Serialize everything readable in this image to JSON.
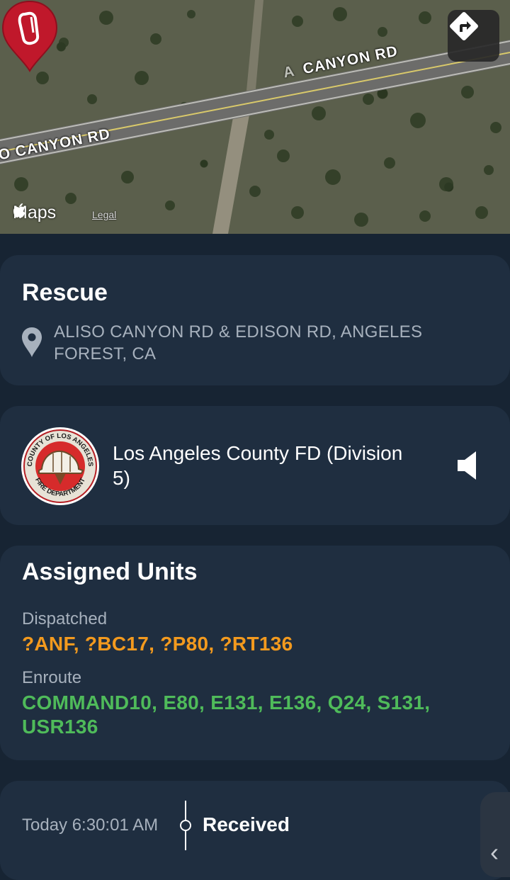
{
  "map": {
    "road_label_top": "CANYON RD",
    "road_label_top_prefix": "A",
    "road_label_left": "O CANYON RD",
    "provider": "Maps",
    "legal": "Legal",
    "directions_icon": "turn-right-arrow-icon",
    "pin_icon": "carabiner-icon",
    "pin_color": "#c0182b"
  },
  "incident": {
    "type": "Rescue",
    "address": "ALISO CANYON RD & EDISON RD, ANGELES FOREST, CA"
  },
  "department": {
    "name": "Los Angeles County FD (Division 5)",
    "logo_ring_top": "COUNTY OF LOS ANGELES",
    "logo_ring_bottom": "FIRE DEPARTMENT",
    "speaker_icon": "speaker-icon"
  },
  "units": {
    "title": "Assigned Units",
    "dispatched_label": "Dispatched",
    "dispatched": "?ANF, ?BC17, ?P80, ?RT136",
    "enroute_label": "Enroute",
    "enroute": "COMMAND10, E80, E131, E136, Q24, S131, USR136",
    "dispatched_color": "#f39a1e",
    "enroute_color": "#4fbb5a"
  },
  "timeline": {
    "time": "Today 6:30:01 AM",
    "status": "Received"
  },
  "side_handle_glyph": "‹"
}
